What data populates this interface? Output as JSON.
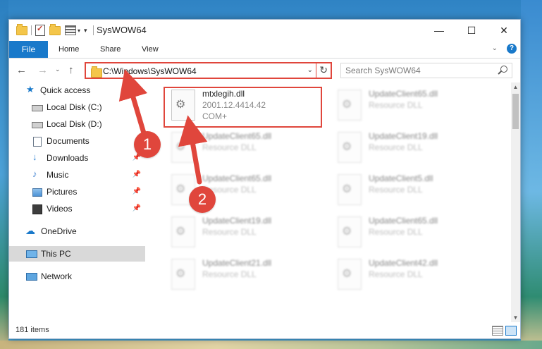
{
  "window": {
    "title": "SysWOW64",
    "controls": {
      "minimize": "—",
      "maximize": "☐",
      "close": "✕"
    }
  },
  "ribbon": {
    "tabs": [
      "File",
      "Home",
      "Share",
      "View"
    ],
    "help": "?"
  },
  "nav": {
    "address": "C:\\Windows\\SysWOW64",
    "search_placeholder": "Search SysWOW64"
  },
  "sidebar": {
    "items": [
      {
        "label": "Quick access",
        "icon": "star-icon",
        "pinned": false
      },
      {
        "label": "Local Disk (C:)",
        "icon": "drive-icon",
        "pinned": false
      },
      {
        "label": "Local Disk (D:)",
        "icon": "drive-icon",
        "pinned": false
      },
      {
        "label": "Documents",
        "icon": "documents-icon",
        "pinned": false
      },
      {
        "label": "Downloads",
        "icon": "download-icon",
        "pinned": true
      },
      {
        "label": "Music",
        "icon": "music-icon",
        "pinned": true
      },
      {
        "label": "Pictures",
        "icon": "pictures-icon",
        "pinned": true
      },
      {
        "label": "Videos",
        "icon": "videos-icon",
        "pinned": true
      },
      {
        "label": "OneDrive",
        "icon": "cloud-icon",
        "pinned": false
      },
      {
        "label": "This PC",
        "icon": "computer-icon",
        "pinned": false,
        "selected": true
      },
      {
        "label": "Network",
        "icon": "network-icon",
        "pinned": false
      }
    ],
    "pin_glyph": "📌"
  },
  "files": {
    "highlighted": {
      "name": "mtxlegih.dll",
      "version": "2001.12.4414.42",
      "type": "COM+"
    },
    "others": [
      {
        "name": "UpdateClient65.dll",
        "type": "Resource DLL"
      },
      {
        "name": "UpdateClient65.dll",
        "type": "Resource DLL"
      },
      {
        "name": "UpdateClient19.dll",
        "type": "Resource DLL"
      },
      {
        "name": "UpdateClient65.dll",
        "type": "Resource DLL"
      },
      {
        "name": "UpdateClient5.dll",
        "type": "Resource DLL"
      },
      {
        "name": "UpdateClient19.dll",
        "type": "Resource DLL"
      },
      {
        "name": "UpdateClient65.dll",
        "type": "Resource DLL"
      },
      {
        "name": "UpdateClient21.dll",
        "type": "Resource DLL"
      },
      {
        "name": "UpdateClient42.dll",
        "type": "Resource DLL"
      }
    ]
  },
  "status": {
    "item_count": "181 items"
  },
  "annotations": {
    "callout_1": "1",
    "callout_2": "2",
    "color": "#e0463c"
  }
}
